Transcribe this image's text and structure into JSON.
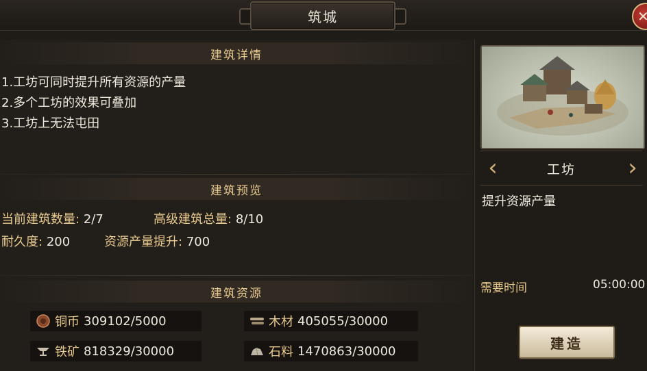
{
  "window": {
    "title": "筑城",
    "close_glyph": "✕"
  },
  "details": {
    "heading": "建筑详情",
    "lines": [
      "1.工坊可同时提升所有资源的产量",
      "2.多个工坊的效果可叠加",
      "3.工坊上无法屯田"
    ]
  },
  "preview": {
    "heading": "建筑预览",
    "count_label": "当前建筑数量:",
    "count_value": "2/7",
    "advanced_label": "高级建筑总量:",
    "advanced_value": "8/10",
    "durability_label": "耐久度:",
    "durability_value": "200",
    "boost_label": "资源产量提升:",
    "boost_value": "700"
  },
  "resources": {
    "heading": "建筑资源",
    "items": [
      {
        "icon": "copper-coin-icon",
        "name": "铜币",
        "value": "309102/5000"
      },
      {
        "icon": "wood-icon",
        "name": "木材",
        "value": "405055/30000"
      },
      {
        "icon": "iron-ore-icon",
        "name": "铁矿",
        "value": "818329/30000"
      },
      {
        "icon": "stone-icon",
        "name": "石料",
        "value": "1470863/30000"
      }
    ]
  },
  "building": {
    "prev_glyph": "‹",
    "next_glyph": "›",
    "name": "工坊",
    "description": "提升资源产量",
    "time_label": "需要时间",
    "time_value": "05:00:00",
    "build_label": "建造"
  },
  "colors": {
    "accent": "#e8c98e",
    "text": "#efe9dd",
    "background": "#221e1a"
  }
}
